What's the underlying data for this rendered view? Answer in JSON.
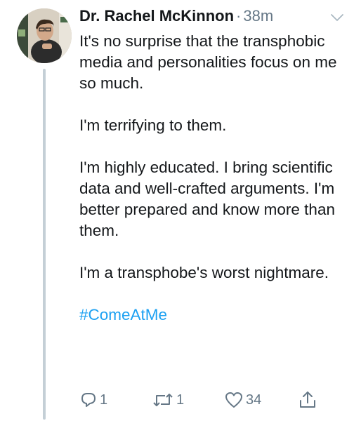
{
  "tweet": {
    "author_name": "Dr. Rachel McKinnon",
    "separator": "·",
    "time": "38m",
    "paragraphs": [
      "It's no surprise that the transphobic media and personalities focus on me so much.",
      "I'm terrifying to them.",
      "I'm highly educated. I bring scientific data and well-crafted arguments. I'm better prepared and know more than them.",
      "I'm a transphobe's worst nightmare."
    ],
    "hashtag": "#ComeAtMe"
  },
  "actions": {
    "reply_icon": "reply-icon",
    "reply_count": "1",
    "retweet_icon": "retweet-icon",
    "retweet_count": "1",
    "like_icon": "heart-icon",
    "like_count": "34",
    "share_icon": "share-icon"
  },
  "colors": {
    "text": "#14171a",
    "secondary": "#657786",
    "link": "#1da1f2",
    "thread_line": "#c4cfd6"
  }
}
